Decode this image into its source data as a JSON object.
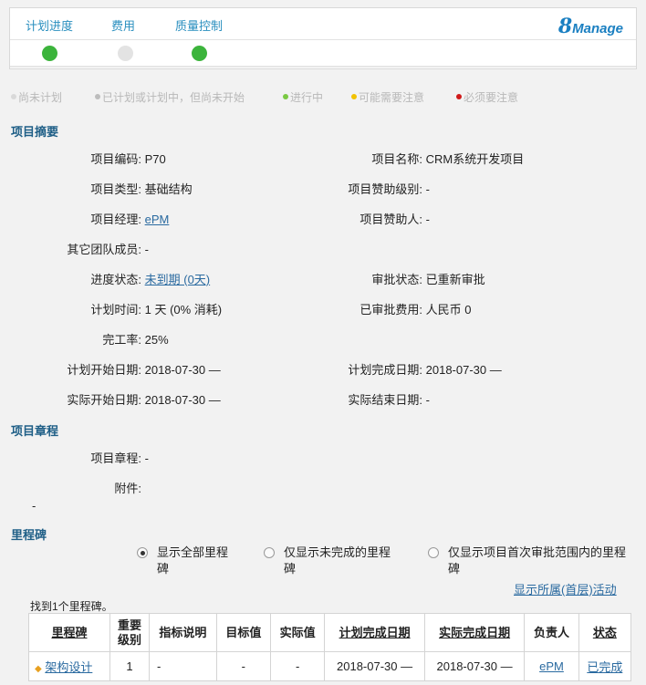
{
  "topbar": {
    "tabs": [
      {
        "label": "计划进度",
        "status_color": "#3cb43c"
      },
      {
        "label": "费用",
        "status_color": "#e3e3e3"
      },
      {
        "label": "质量控制",
        "status_color": "#3cb43c"
      }
    ],
    "logo_num": "8",
    "logo_word": "Manage"
  },
  "legend": [
    {
      "label": "尚未计划",
      "color": "#d9d9d9"
    },
    {
      "label": "已计划或计划中，但尚未开始",
      "color": "#bdbdbd"
    },
    {
      "label": "进行中",
      "color": "#7ac943"
    },
    {
      "label": "可能需要注意",
      "color": "#f2c200"
    },
    {
      "label": "必须要注意",
      "color": "#d01a1a"
    }
  ],
  "summary": {
    "title": "项目摘要",
    "project_code_label": "项目编码:",
    "project_code": "P70",
    "project_name_label": "项目名称:",
    "project_name": "CRM系统开发项目",
    "project_type_label": "项目类型:",
    "project_type": "基础结构",
    "sponsor_level_label": "项目赞助级别:",
    "sponsor_level": "-",
    "manager_label": "项目经理:",
    "manager": "ePM",
    "sponsor_label": "项目赞助人:",
    "sponsor": "-",
    "team_label": "其它团队成员:",
    "team": "-",
    "progress_label": "进度状态:",
    "progress": "未到期 (0天)",
    "approval_label": "审批状态:",
    "approval": "已重新审批",
    "plan_time_label": "计划时间:",
    "plan_time": "1 天 (0% 消耗)",
    "approved_cost_label": "已审批费用:",
    "approved_cost": "人民币 0",
    "completion_label": "完工率:",
    "completion": "25%",
    "plan_start_label": "计划开始日期:",
    "plan_start": "2018-07-30 —",
    "plan_end_label": "计划完成日期:",
    "plan_end": "2018-07-30 —",
    "actual_start_label": "实际开始日期:",
    "actual_start": "2018-07-30 —",
    "actual_end_label": "实际结束日期:",
    "actual_end": "-"
  },
  "charter": {
    "title": "项目章程",
    "charter_label": "项目章程:",
    "charter": "-",
    "attachment_label": "附件:",
    "trailing": "-"
  },
  "milestones": {
    "title": "里程碑",
    "radio_options": [
      {
        "line1": "显示全部里程",
        "line2": "碑",
        "selected": true
      },
      {
        "line1": "仅显示未完成的里程",
        "line2": "碑",
        "selected": false
      },
      {
        "line1": "仅显示项目首次审批范围内的里程",
        "line2": "碑",
        "selected": false
      }
    ],
    "show_link": "显示所属(首层)活动",
    "found_text": "找到1个里程碑。",
    "columns": [
      "里程碑",
      "重要级别",
      "指标说明",
      "目标值",
      "实际值",
      "计划完成日期",
      "实际完成日期",
      "负责人",
      "状态"
    ],
    "columns_line1_2": {
      "importance_1": "重要",
      "importance_2": "级别"
    },
    "rows": [
      {
        "name": "架构设计",
        "importance": "1",
        "indicator": "-",
        "target": "-",
        "actual": "-",
        "plan_end": "2018-07-30 —",
        "actual_end": "2018-07-30 —",
        "owner": "ePM",
        "status": "已完成"
      }
    ]
  }
}
